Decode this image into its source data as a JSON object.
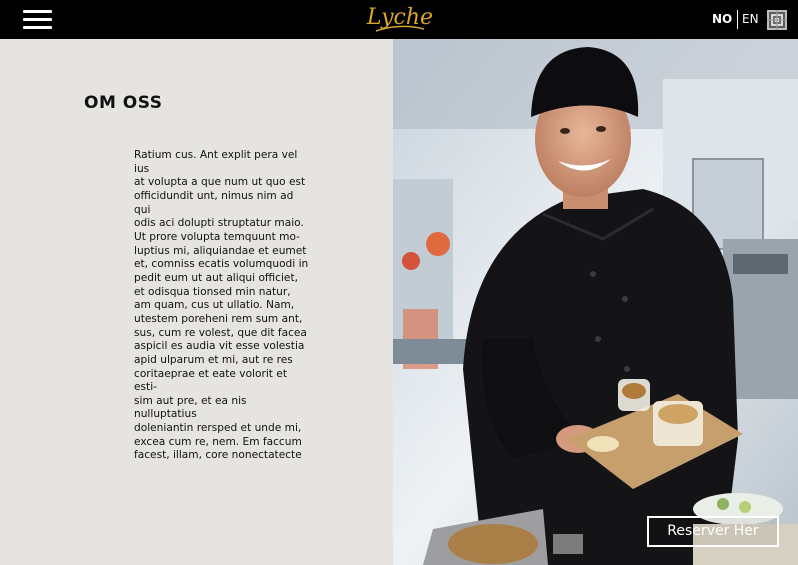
{
  "header": {
    "menu_icon": "hamburger-menu-icon",
    "logo_text": "Lyche",
    "lang_no": "NO",
    "lang_en": "EN",
    "pattern_icon": "pattern-logo-icon"
  },
  "about": {
    "title": "OM OSS",
    "body": "Ratium cus. Ant explit pera vel ius\nat volupta a que num ut quo est\nofficidundit unt, nimus nim ad qui\nodis aci dolupti struptatur maio.\nUt prore volupta temquunt mo-\nluptius mi, aliquiandae et eumet\net, comniss ecatis volumquodi in\npedit eum ut aut aliqui officiet,\net odisqua tionsed min natur,\nam quam, cus ut ullatio. Nam,\nutestem poreheni rem sum ant,\nsus, cum re volest, que dit facea\naspicil es audia vit esse volestia\napid ulparum et mi, aut re res\ncoritaeprae et eate volorit et esti-\nsim aut pre, et ea nis nulluptatius\ndoleniantin rersped et unde mi,\nexcea cum re, nem. Em faccum\nfacest, illam, core nonectatecte"
  },
  "hero": {
    "image_desc": "chef-photo",
    "reserve_label": "Reserver Her"
  },
  "colors": {
    "topbar": "#000000",
    "background": "#e6e4e0",
    "logo_gold": "#d8a42c"
  }
}
